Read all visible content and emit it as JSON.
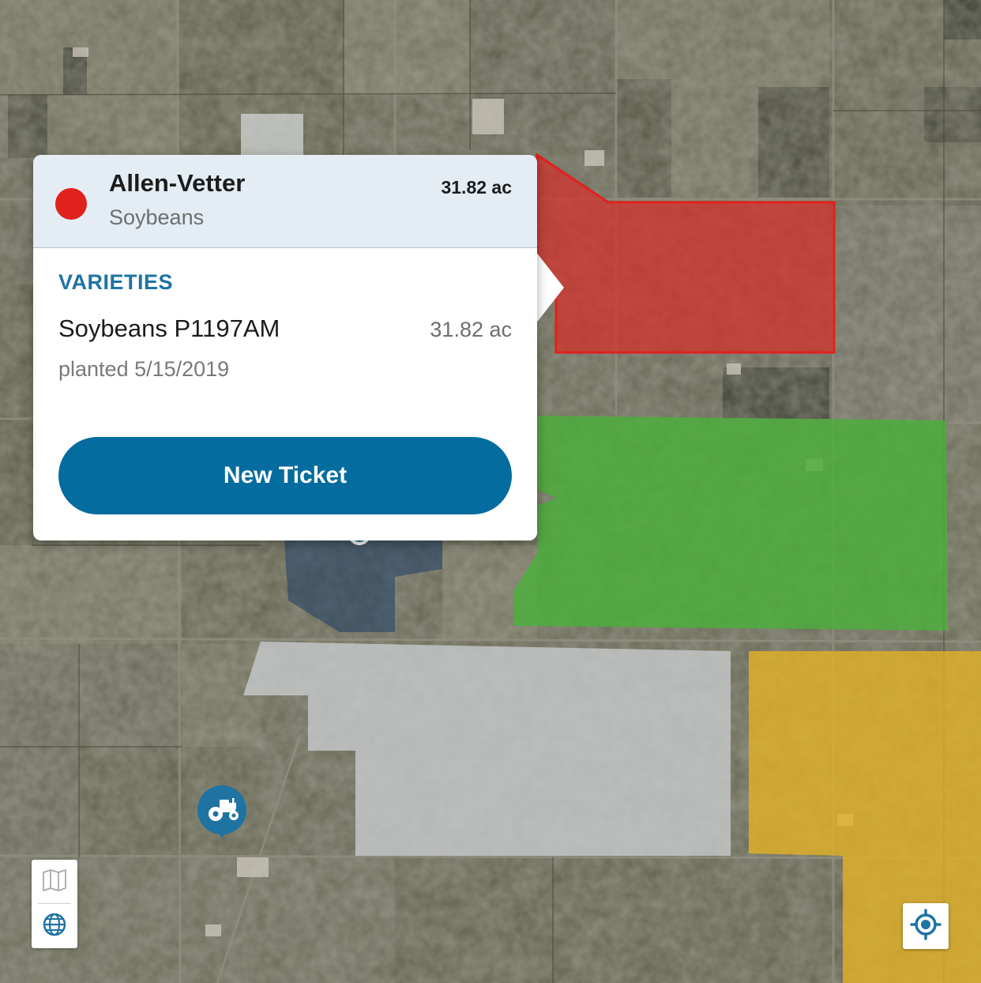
{
  "popup": {
    "field_name": "Allen-Vetter",
    "crop": "Soybeans",
    "acres": "31.82 ac",
    "status_color": "#e0211d",
    "varieties_heading": "VARIETIES",
    "variety": {
      "name": "Soybeans P1197AM",
      "acres": "31.82 ac",
      "planted": "planted 5/15/2019"
    },
    "button_label": "New Ticket",
    "button_color": "#046c9e"
  },
  "map": {
    "type": "satellite",
    "field_colors": {
      "red": "#d62f2a",
      "green": "#4caf3c",
      "gray": "#c4c8c9",
      "yellow": "#e5b224"
    },
    "accent_color": "#1f73a3"
  },
  "controls": {
    "map_view_icon": "map-icon",
    "satellite_view_icon": "globe-icon",
    "locate_icon": "crosshair-icon",
    "equipment_icon": "tractor-icon"
  }
}
